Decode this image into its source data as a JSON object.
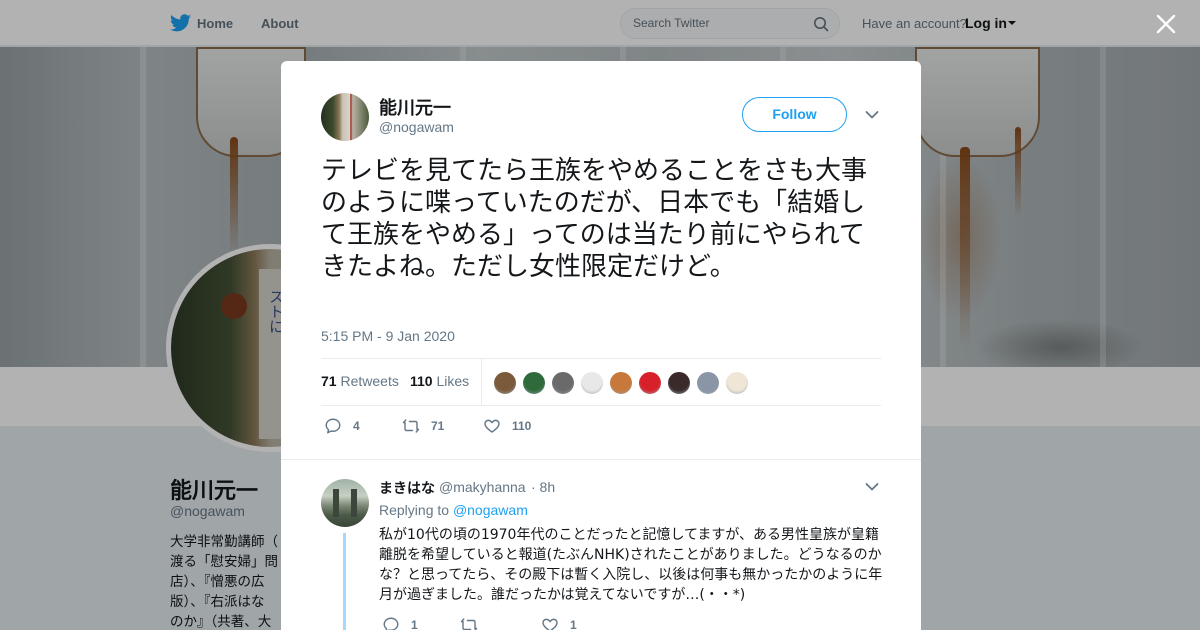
{
  "nav": {
    "home_label": "Home",
    "about_label": "About",
    "search_placeholder": "Search Twitter",
    "have_account": "Have an account?",
    "login_label": "Log in",
    "brand_color": "#1da1f2"
  },
  "profile": {
    "name": "能川元一",
    "handle": "@nogawam",
    "bio_lines": [
      "大学非常勤講師（",
      "渡る「慰安婦」問",
      "店）、『憎悪の広",
      "版）、『右派はな",
      "のか』（共著、大"
    ],
    "avatar_text": "投入 雑誌類は このポストに"
  },
  "tweet": {
    "author_name": "能川元一",
    "author_handle": "@nogawam",
    "follow_label": "Follow",
    "text": "テレビを見てたら王族をやめることをさも大事のように喋っていたのだが、日本でも「結婚して王族をやめる」ってのは当たり前にやられてきたよね。ただし女性限定だけど。",
    "timestamp": "5:15 PM - 9 Jan 2020",
    "retweets_count": "71",
    "retweets_label": "Retweets",
    "likes_count": "110",
    "likes_label": "Likes",
    "actions": {
      "replies": "4",
      "retweets": "71",
      "likes": "110"
    }
  },
  "liker_avatar_colors": [
    "#7a5a3a",
    "#2e6a3a",
    "#6a6a6a",
    "#e8e8e8",
    "#c8783a",
    "#d8202a",
    "#3a2a2a",
    "#8a96a6",
    "#efe6d6"
  ],
  "reply": {
    "name": "まきはな",
    "handle": "@makyhanna",
    "time": "· 8h",
    "replying_prefix": "Replying to",
    "replying_to": "@nogawam",
    "text": "私が10代の頃の1970年代のことだったと記憶してますが、ある男性皇族が皇籍離脱を希望していると報道(たぶんNHK)されたことがありました。どうなるのかな？と思ってたら、その殿下は暫く入院し、以後は何事も無かったかのように年月が過ぎました。誰だったかは覚えてないですが…(・・*)",
    "actions": {
      "replies": "1",
      "retweets": "",
      "likes": "1"
    }
  }
}
